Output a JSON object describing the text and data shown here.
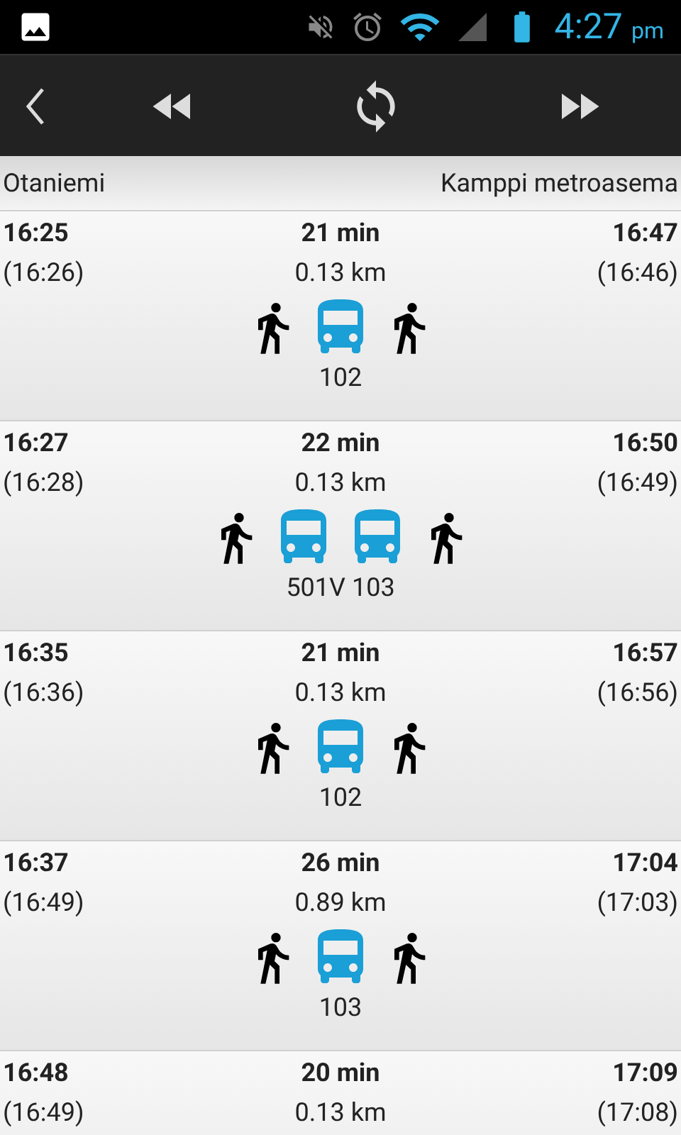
{
  "status_bar": {
    "time": "4:27",
    "ampm": "pm"
  },
  "header": {
    "from": "Otaniemi",
    "to": "Kamppi metroasema"
  },
  "routes": [
    {
      "depart": "16:25",
      "depart_planned": "(16:26)",
      "duration": "21 min",
      "walk": "0.13 km",
      "arrive": "16:47",
      "arrive_planned": "(16:46)",
      "legs": [
        {
          "kind": "walk"
        },
        {
          "kind": "bus"
        },
        {
          "kind": "walk"
        }
      ],
      "lines": "102"
    },
    {
      "depart": "16:27",
      "depart_planned": "(16:28)",
      "duration": "22 min",
      "walk": "0.13 km",
      "arrive": "16:50",
      "arrive_planned": "(16:49)",
      "legs": [
        {
          "kind": "walk"
        },
        {
          "kind": "bus"
        },
        {
          "kind": "bus"
        },
        {
          "kind": "walk"
        }
      ],
      "lines": "501V 103"
    },
    {
      "depart": "16:35",
      "depart_planned": "(16:36)",
      "duration": "21 min",
      "walk": "0.13 km",
      "arrive": "16:57",
      "arrive_planned": "(16:56)",
      "legs": [
        {
          "kind": "walk"
        },
        {
          "kind": "bus"
        },
        {
          "kind": "walk"
        }
      ],
      "lines": "102"
    },
    {
      "depart": "16:37",
      "depart_planned": "(16:49)",
      "duration": "26 min",
      "walk": "0.89 km",
      "arrive": "17:04",
      "arrive_planned": "(17:03)",
      "legs": [
        {
          "kind": "walk"
        },
        {
          "kind": "bus"
        },
        {
          "kind": "walk"
        }
      ],
      "lines": "103"
    },
    {
      "depart": "16:48",
      "depart_planned": "(16:49)",
      "duration": "20 min",
      "walk": "0.13 km",
      "arrive": "17:09",
      "arrive_planned": "(17:08)"
    }
  ]
}
